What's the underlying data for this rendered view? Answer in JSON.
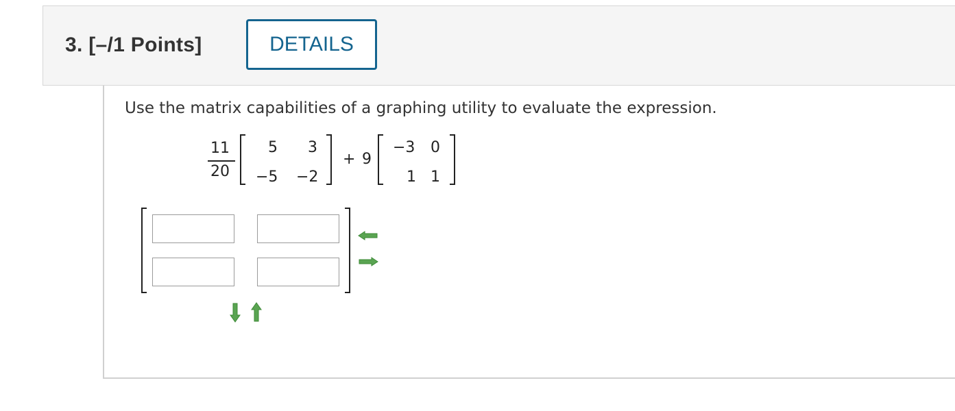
{
  "question": {
    "label": "3. [–/1 Points]",
    "details_button": "DETAILS"
  },
  "problem": {
    "instructions": "Use the matrix capabilities of a graphing utility to evaluate the expression.",
    "fraction_numerator": "11",
    "fraction_denominator": "20",
    "matrix_a": [
      [
        "5",
        "3"
      ],
      [
        "−5",
        "−2"
      ]
    ],
    "operator": "+",
    "scalar_b": "9",
    "matrix_b": [
      [
        "−3",
        "0"
      ],
      [
        "1",
        "1"
      ]
    ]
  },
  "answer_matrix": {
    "cells": [
      [
        "",
        ""
      ],
      [
        "",
        ""
      ]
    ]
  },
  "icons": {
    "remove_column": "arrow-left-icon",
    "add_column": "arrow-right-icon",
    "add_row": "arrow-down-icon",
    "remove_row": "arrow-up-icon",
    "arrow_color": "#5aa452"
  }
}
